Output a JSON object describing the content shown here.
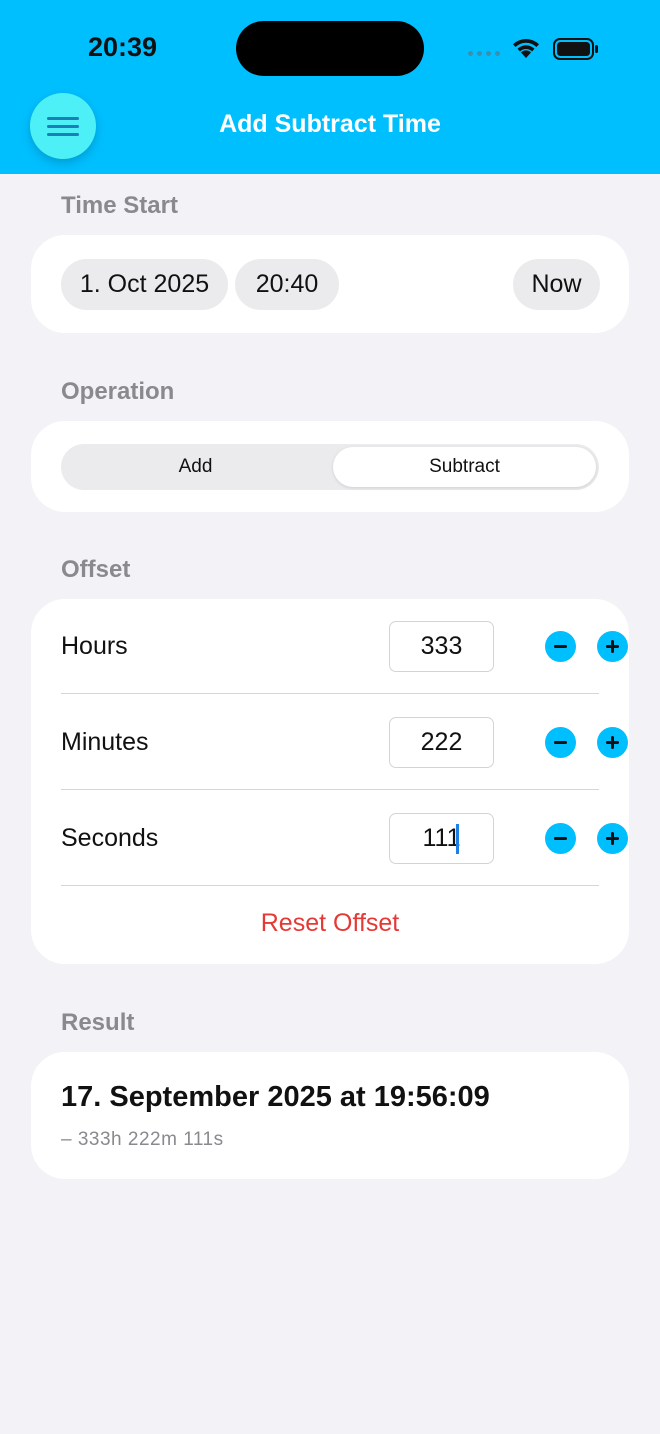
{
  "status": {
    "time": "20:39"
  },
  "nav": {
    "title": "Add Subtract Time"
  },
  "time_start": {
    "label": "Time Start",
    "date": "1. Oct 2025",
    "time": "20:40",
    "now_label": "Now"
  },
  "operation": {
    "label": "Operation",
    "options": [
      "Add",
      "Subtract"
    ],
    "selected": "Subtract"
  },
  "offset": {
    "label": "Offset",
    "rows": [
      {
        "label": "Hours",
        "value": "333"
      },
      {
        "label": "Minutes",
        "value": "222"
      },
      {
        "label": "Seconds",
        "value": "111"
      }
    ],
    "reset_label": "Reset Offset"
  },
  "result": {
    "label": "Result",
    "value": "17. September 2025 at 19:56:09",
    "detail": "– 333h 222m 111s"
  },
  "colors": {
    "accent": "#00bfff",
    "menu_button": "#4cf0f6",
    "destructive": "#e53935",
    "background": "#f2f2f7"
  }
}
